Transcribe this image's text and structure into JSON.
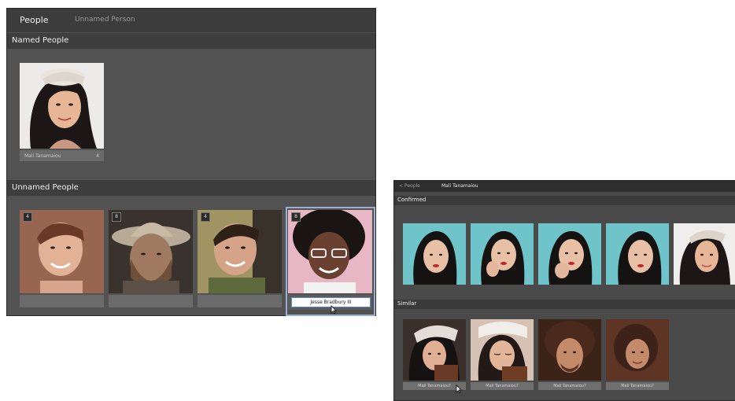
{
  "left_window": {
    "tabs": {
      "active": "People",
      "inactive": "Unnamed Person"
    },
    "named_section": {
      "title": "Named People"
    },
    "named_people": [
      {
        "caption": "Mali Tanamaiou",
        "caption_suffix": "4"
      }
    ],
    "unnamed_section": {
      "title": "Unnamed People"
    },
    "unnamed_people": [
      {
        "badge": "4",
        "caption": ""
      },
      {
        "badge": "8",
        "caption": ""
      },
      {
        "badge": "4",
        "caption": ""
      },
      {
        "badge": "8",
        "input_value": "Jesse Bradbury III"
      }
    ]
  },
  "right_window": {
    "back_link": "< People",
    "person_name": "Mali Tanamaiou",
    "confirmed_section": {
      "title": "Confirmed"
    },
    "similar_section": {
      "title": "Similar"
    },
    "similar_captions": [
      "Mali Tanamaiou?",
      "Mali Tanamaiou?",
      "Mali Tanamaiou?",
      "Mali Tanamaiou?"
    ]
  },
  "colors": {
    "panel_bg": "#525252",
    "header_bg": "#3e3e3e",
    "topbar_bg": "#3c3c3c",
    "confirmed_bg": "#6ec4c8",
    "selection": "#9ab0cf"
  }
}
